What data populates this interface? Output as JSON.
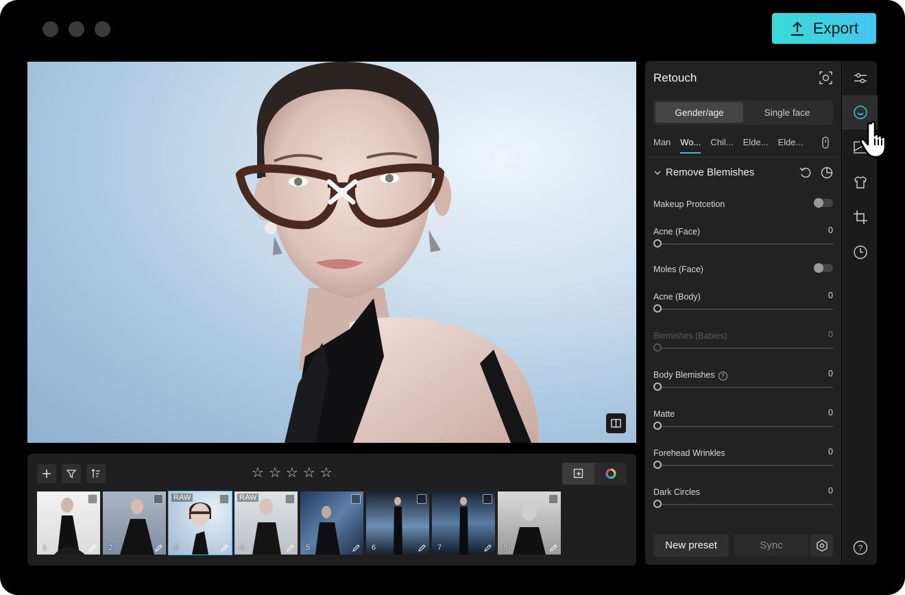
{
  "window": {
    "controls": [
      "close",
      "minimize",
      "maximize"
    ]
  },
  "export": {
    "label": "Export",
    "icon": "upload-icon"
  },
  "canvas": {
    "compare_icon": "split-compare-icon"
  },
  "filmstrip": {
    "tools": [
      "add-icon",
      "filter-icon",
      "sort-icon"
    ],
    "rating_stars": 5,
    "rating_value": 0,
    "view_toggle": [
      "add-to-export-icon",
      "color-wheel-icon"
    ],
    "thumbnails": [
      {
        "num": "1",
        "raw": "",
        "selected": false
      },
      {
        "num": "2",
        "raw": "",
        "selected": false
      },
      {
        "num": "3",
        "raw": "RAW",
        "selected": true
      },
      {
        "num": "4",
        "raw": "RAW",
        "selected": false
      },
      {
        "num": "5",
        "raw": "",
        "selected": false
      },
      {
        "num": "6",
        "raw": "",
        "selected": false
      },
      {
        "num": "7",
        "raw": "",
        "selected": false
      },
      {
        "num": "8",
        "raw": "",
        "selected": false
      }
    ]
  },
  "panel": {
    "title": "Retouch",
    "modes": {
      "gender_age": "Gender/age",
      "single_face": "Single face"
    },
    "gender_tabs": [
      "Man",
      "Wo...",
      "Chil...",
      "Elde...",
      "Elde..."
    ],
    "section": "Remove Blemishes",
    "controls": {
      "makeup": {
        "label": "Makeup Protcetion"
      },
      "acne_face": {
        "label": "Acne (Face)",
        "value": "0"
      },
      "moles": {
        "label": "Moles (Face)"
      },
      "acne_body": {
        "label": "Acne (Body)",
        "value": "0"
      },
      "blemishes_babies": {
        "label": "Blemishes (Babies)",
        "value": "0"
      },
      "body_blemishes": {
        "label": "Body Blemishes",
        "value": "0",
        "help": "?"
      },
      "matte": {
        "label": "Matte",
        "value": "0"
      },
      "forehead": {
        "label": "Forehead Wrinkles",
        "value": "0"
      },
      "dark_circles": {
        "label": "Dark Circles",
        "value": "0"
      }
    },
    "buttons": {
      "new_preset": "New preset",
      "sync": "Sync"
    }
  },
  "rail": {
    "items": [
      "adjust-sliders-icon",
      "face-retouch-icon",
      "background-icon",
      "clothing-icon",
      "crop-icon",
      "history-icon",
      "help-icon"
    ],
    "help_text": "?"
  },
  "colors": {
    "accent": "#35c2d9",
    "export_gradient_start": "#3bdad6",
    "export_gradient_end": "#45c6f0"
  }
}
